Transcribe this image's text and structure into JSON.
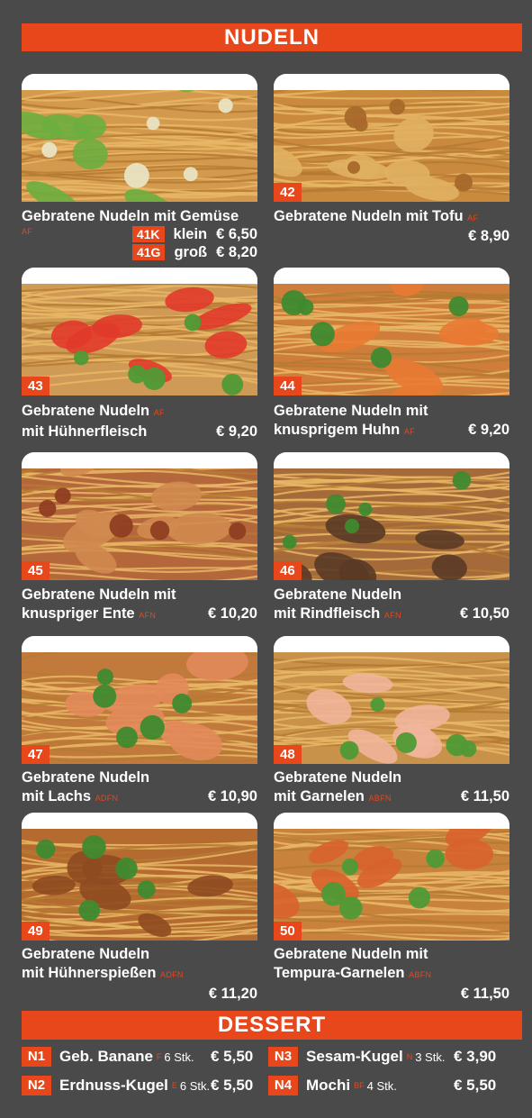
{
  "header": {
    "title": "NUDELN"
  },
  "dishes": [
    {
      "number": "",
      "name_line1": "Gebratene Nudeln mit Gemüse",
      "name_line2": "",
      "allergens": "AF",
      "price": "",
      "sizes": [
        {
          "code": "41K",
          "label": "klein",
          "price": "€ 6,50"
        },
        {
          "code": "41G",
          "label": "groß",
          "price": "€ 8,20"
        }
      ],
      "photo_colors": {
        "base": "#d39a4e",
        "accent": "#6cae3f",
        "extra": "#e9e3c3"
      }
    },
    {
      "number": "42",
      "name_line1": "Gebratene Nudeln mit Tofu",
      "name_line2": "",
      "allergens": "AF",
      "price": "€ 8,90",
      "photo_colors": {
        "base": "#c98a3e",
        "accent": "#e0b062",
        "extra": "#a8692a"
      }
    },
    {
      "number": "43",
      "name_line1": "Gebratene Nudeln",
      "name_line2": "mit Hühnerfleisch",
      "allergens": "AF",
      "price": "€ 9,20",
      "photo_colors": {
        "base": "#cf9a55",
        "accent": "#e13a2a",
        "extra": "#4f9a36"
      }
    },
    {
      "number": "44",
      "name_line1": "Gebratene Nudeln mit",
      "name_line2": "knusprigem Huhn",
      "allergens": "AF",
      "price": "€ 9,20",
      "photo_colors": {
        "base": "#cf7d3a",
        "accent": "#e97a33",
        "extra": "#3f8a2f"
      }
    },
    {
      "number": "45",
      "name_line1": "Gebratene Nudeln mit",
      "name_line2": "knuspriger Ente",
      "allergens": "AFN",
      "price": "€ 10,20",
      "photo_colors": {
        "base": "#b5673c",
        "accent": "#d08a4f",
        "extra": "#8f3e22"
      }
    },
    {
      "number": "46",
      "name_line1": "Gebratene Nudeln",
      "name_line2": "mit Rindfleisch",
      "allergens": "AFN",
      "price": "€ 10,50",
      "photo_colors": {
        "base": "#a56a3a",
        "accent": "#5a3a26",
        "extra": "#3f8a2f"
      }
    },
    {
      "number": "47",
      "name_line1": "Gebratene Nudeln",
      "name_line2": "mit Lachs",
      "allergens": "ADFN",
      "price": "€ 10,90",
      "photo_colors": {
        "base": "#c27a3c",
        "accent": "#e28a5a",
        "extra": "#3f8a2f"
      }
    },
    {
      "number": "48",
      "name_line1": "Gebratene Nudeln",
      "name_line2": "mit Garnelen",
      "allergens": "ABFN",
      "price": "€ 11,50",
      "photo_colors": {
        "base": "#c8924b",
        "accent": "#f0b59a",
        "extra": "#4f9a36"
      }
    },
    {
      "number": "49",
      "name_line1": "Gebratene Nudeln",
      "name_line2": "mit Hühnerspießen",
      "allergens": "ADFN",
      "price": "€ 11,20",
      "photo_colors": {
        "base": "#b56a30",
        "accent": "#8e4a20",
        "extra": "#3f8a2f"
      }
    },
    {
      "number": "50",
      "name_line1": "Gebratene Nudeln mit",
      "name_line2": "Tempura-Garnelen",
      "allergens": "ABFN",
      "price": "€ 11,50",
      "photo_colors": {
        "base": "#c8823c",
        "accent": "#d8622c",
        "extra": "#4f9a36"
      }
    }
  ],
  "dessert": {
    "title": "DESSERT",
    "items": [
      {
        "code": "N1",
        "name": "Geb. Banane",
        "allergens": "F",
        "qty": "6 Stk.",
        "price": "€ 5,50"
      },
      {
        "code": "N2",
        "name": "Erdnuss-Kugel",
        "allergens": "E",
        "qty": "6 Stk.",
        "price": "€ 5,50"
      },
      {
        "code": "N3",
        "name": "Sesam-Kugel",
        "allergens": "N",
        "qty": "3 Stk.",
        "price": "€ 3,90"
      },
      {
        "code": "N4",
        "name": "Mochi",
        "allergens": "BF",
        "qty": "4 Stk.",
        "price": "€ 5,50"
      }
    ]
  },
  "colors": {
    "background": "#4a4a4a",
    "accent": "#e8461b",
    "text": "#ffffff"
  }
}
